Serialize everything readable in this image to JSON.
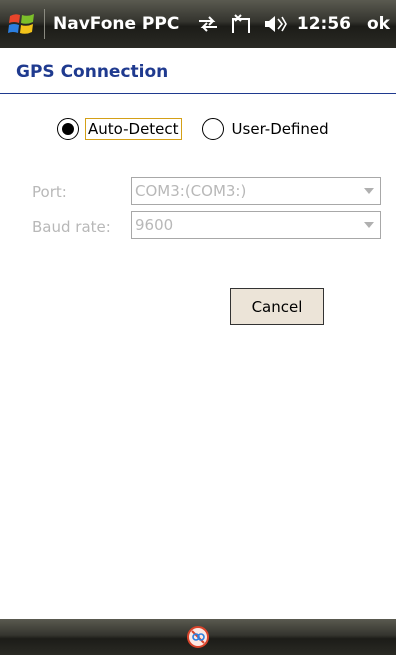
{
  "titlebar": {
    "app_title": "NavFone PPC",
    "clock": "12:56",
    "ok_label": "ok"
  },
  "page": {
    "title": "GPS Connection"
  },
  "radios": {
    "auto_detect_label": "Auto-Detect",
    "user_defined_label": "User-Defined",
    "selected": "Auto-Detect"
  },
  "fields": {
    "port_label": "Port:",
    "port_value": "COM3:(COM3:)",
    "baud_label": "Baud rate:",
    "baud_value": "9600"
  },
  "buttons": {
    "cancel_label": "Cancel"
  },
  "colors": {
    "title_blue": "#1f3a8f",
    "disabled_text": "#b8b8b8",
    "button_face": "#ece4d8"
  }
}
